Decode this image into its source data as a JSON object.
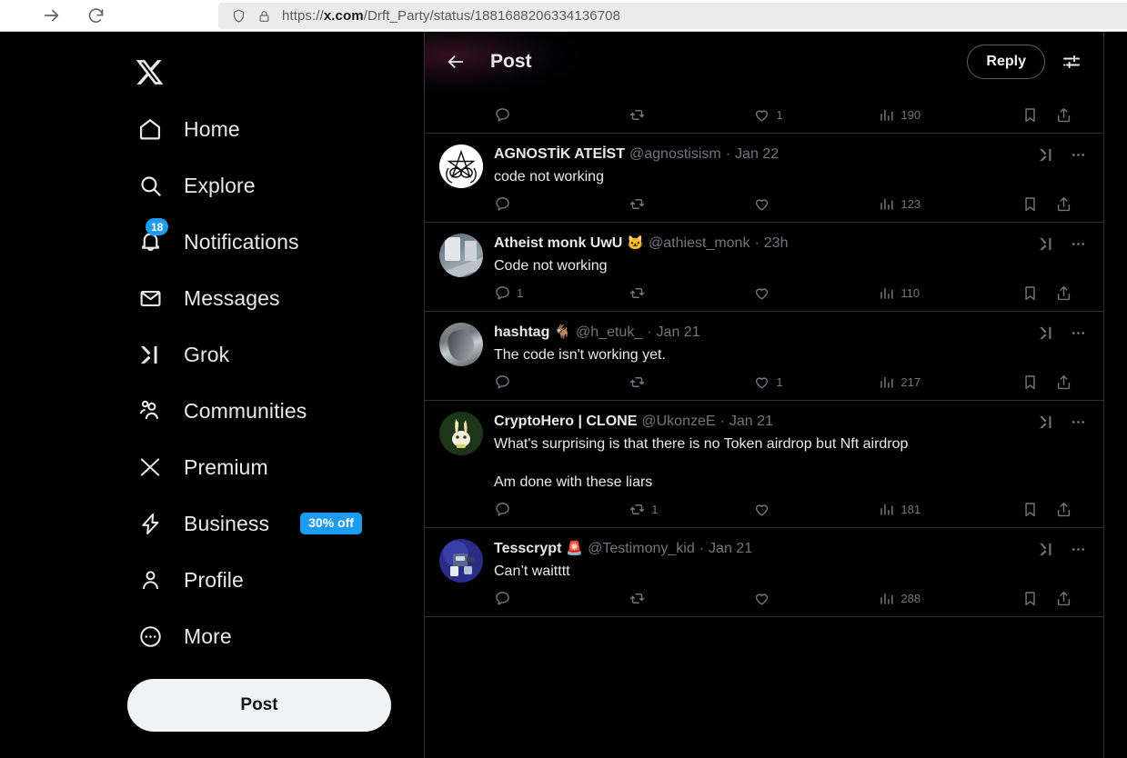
{
  "browser": {
    "url_prefix": "https://",
    "url_domain": "x.com",
    "url_path": "/Drft_Party/status/1881688206334136708",
    "forward_icon": "forward-arrow-icon",
    "reload_icon": "reload-icon",
    "shield_icon": "shield-icon",
    "lock_icon": "lock-icon"
  },
  "sidebar": {
    "logo": "x-logo",
    "items": [
      {
        "label": "Home",
        "icon": "home-icon"
      },
      {
        "label": "Explore",
        "icon": "search-icon"
      },
      {
        "label": "Notifications",
        "icon": "bell-icon",
        "badge": "18"
      },
      {
        "label": "Messages",
        "icon": "envelope-icon"
      },
      {
        "label": "Grok",
        "icon": "grok-icon"
      },
      {
        "label": "Communities",
        "icon": "people-icon"
      },
      {
        "label": "Premium",
        "icon": "x-icon"
      },
      {
        "label": "Business",
        "icon": "lightning-icon",
        "promo": "30% off"
      },
      {
        "label": "Profile",
        "icon": "person-icon"
      },
      {
        "label": "More",
        "icon": "more-circle-icon"
      }
    ],
    "post_button": "Post"
  },
  "header": {
    "back_icon": "back-arrow-icon",
    "title": "Post",
    "reply_button": "Reply",
    "settings_icon": "sliders-icon"
  },
  "colors": {
    "accent_blue": "#1d9bf0",
    "text_primary": "#e7e9ea",
    "text_muted": "#71767b",
    "border": "#2f3336",
    "background": "#000000"
  },
  "partial_tweet_actions": {
    "reply_count": "",
    "retweet_count": "",
    "like_count": "1",
    "views_count": "190"
  },
  "tweets": [
    {
      "name": "AGNOSTİK ATEİST",
      "emoji": "",
      "handle": "@agnostisism",
      "separator": "·",
      "time": "Jan 22",
      "text": "code not working",
      "avatar": "av-pentagram",
      "reply_count": "",
      "retweet_count": "",
      "like_count": "",
      "views_count": "123"
    },
    {
      "name": "Atheist monk UwU",
      "emoji": "🐱",
      "handle": "@athiest_monk",
      "separator": "·",
      "time": "23h",
      "text": "Code not working",
      "avatar": "av-monk",
      "reply_count": "1",
      "retweet_count": "",
      "like_count": "",
      "views_count": "110"
    },
    {
      "name": "hashtag",
      "emoji": "🐐",
      "handle": "@h_etuk_",
      "separator": "·",
      "time": "Jan 21",
      "text": "The code isn't working yet.",
      "avatar": "av-hashtag",
      "reply_count": "",
      "retweet_count": "",
      "like_count": "1",
      "views_count": "217"
    },
    {
      "name": "CryptoHero | CLONE",
      "emoji": "",
      "handle": "@UkonzeE",
      "separator": "·",
      "time": "Jan 21",
      "text": "What's surprising is that there is no Token airdrop but Nft airdrop\n\nAm done with these liars",
      "avatar": "av-rabbit",
      "reply_count": "",
      "retweet_count": "1",
      "like_count": "",
      "views_count": "181"
    },
    {
      "name": "Tesscrypt",
      "emoji": "🚨",
      "handle": "@Testimony_kid",
      "separator": "·",
      "time": "Jan 21",
      "text": "Can’t waitttt",
      "avatar": "av-robot",
      "reply_count": "",
      "retweet_count": "",
      "like_count": "",
      "views_count": "288"
    }
  ],
  "icons": {
    "reply": "comment-icon",
    "retweet": "retweet-icon",
    "like": "heart-icon",
    "views": "analytics-icon",
    "bookmark": "bookmark-icon",
    "share": "share-icon",
    "grok": "grok-icon",
    "more": "more-dots-icon"
  }
}
